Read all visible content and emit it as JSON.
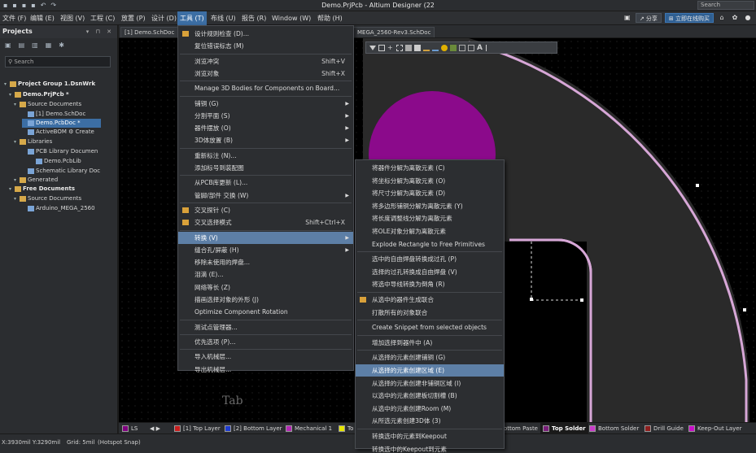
{
  "app": {
    "title": "Demo.PrjPcb - Altium Designer (22",
    "search_placeholder": "Search"
  },
  "quick_icons": [
    "save-icon",
    "save-all-icon",
    "open-icon",
    "folder-icon",
    "undo-icon",
    "redo-icon"
  ],
  "menubar": {
    "items": [
      "文件 (F)",
      "编辑 (E)",
      "视图 (V)",
      "工程 (C)",
      "放置 (P)",
      "设计 (D)",
      "工具 (T)",
      "布线 (U)",
      "报告 (R)",
      "Window (W)",
      "帮助 (H)"
    ],
    "active_index": 6,
    "share": "分享",
    "buy": "立即在线购买"
  },
  "projects_panel": {
    "title": "Projects",
    "search_placeholder": "Search",
    "tree": [
      {
        "label": "Project Group 1.DsnWrk",
        "indent": 0,
        "bold": true
      },
      {
        "label": "Demo.PrjPcb *",
        "indent": 1,
        "bold": true
      },
      {
        "label": "Source Documents",
        "indent": 2
      },
      {
        "label": "[1] Demo.SchDoc",
        "indent": 3
      },
      {
        "label": "Demo.PcbDoc *",
        "indent": 3,
        "selected": true
      },
      {
        "label": "ActiveBOM ⚙  Create",
        "indent": 3
      },
      {
        "label": "Libraries",
        "indent": 2
      },
      {
        "label": "PCB Library Documen",
        "indent": 3
      },
      {
        "label": "Demo.PcbLib",
        "indent": 4
      },
      {
        "label": "Schematic Library Doc",
        "indent": 3
      },
      {
        "label": "Generated",
        "indent": 2
      },
      {
        "label": "Free Documents",
        "indent": 1,
        "bold": true
      },
      {
        "label": "Source Documents",
        "indent": 2
      },
      {
        "label": "Arduino_MEGA_2560",
        "indent": 3
      }
    ]
  },
  "doc_tabs": [
    "[1] Demo.SchDoc",
    "MEGA_2560-Rev3.SchDoc"
  ],
  "canvas": {
    "ghost_text": "Tab",
    "colors": {
      "pad": "#8b0a8b",
      "outline": "#d7a7d7",
      "board": "#2a2a2a"
    }
  },
  "tools_menu": {
    "items": [
      {
        "label": "设计规则检查 (D)...",
        "icon": "drc-icon"
      },
      {
        "label": "复位错误标志 (M)"
      },
      {
        "sep": true
      },
      {
        "label": "浏览冲突",
        "shortcut": "Shift+V"
      },
      {
        "label": "浏览对象",
        "shortcut": "Shift+X"
      },
      {
        "sep": true
      },
      {
        "label": "Manage 3D Bodies for Components on Board..."
      },
      {
        "sep": true
      },
      {
        "label": "铺铜 (G)",
        "submenu": true
      },
      {
        "label": "分割平面 (S)",
        "submenu": true
      },
      {
        "label": "器件摆放 (O)",
        "submenu": true
      },
      {
        "label": "3D体放置 (B)",
        "submenu": true
      },
      {
        "sep": true
      },
      {
        "label": "重新标注 (N)..."
      },
      {
        "label": "添加标号到装配图"
      },
      {
        "sep": true
      },
      {
        "label": "从PCB库更新 (L)..."
      },
      {
        "label": "管脚/部件 交换 (W)",
        "submenu": true
      },
      {
        "sep": true
      },
      {
        "label": "交叉探针 (C)",
        "icon": "cross-probe-icon"
      },
      {
        "label": "交叉选择模式",
        "shortcut": "Shift+Ctrl+X",
        "icon": "cross-select-icon"
      },
      {
        "sep": true
      },
      {
        "label": "转换 (V)",
        "submenu": true,
        "highlight": true
      },
      {
        "label": "缝合孔/屏蔽 (H)",
        "submenu": true
      },
      {
        "label": "移除未使用的焊盘..."
      },
      {
        "label": "泪滴 (E)..."
      },
      {
        "label": "网络等长 (Z)"
      },
      {
        "label": "描画选择对象的外形 (J)"
      },
      {
        "label": "Optimize Component Rotation"
      },
      {
        "sep": true
      },
      {
        "label": "测试点管理器..."
      },
      {
        "sep": true
      },
      {
        "label": "优先选项 (P)..."
      },
      {
        "sep": true
      },
      {
        "label": "导入机械层..."
      },
      {
        "label": "导出机械层..."
      }
    ]
  },
  "convert_menu": {
    "items": [
      {
        "label": "将器件分解为离散元素 (C)"
      },
      {
        "label": "将坐标分解为离散元素 (O)"
      },
      {
        "label": "将尺寸分解为离散元素 (D)"
      },
      {
        "label": "将多边形铺铜分解为离散元素 (Y)"
      },
      {
        "label": "将长度调整线分解为离散元素"
      },
      {
        "label": "将OLE对象分解为离散元素"
      },
      {
        "label": "Explode Rectangle to Free Primitives"
      },
      {
        "sep": true
      },
      {
        "label": "选中的自由焊盘转换成过孔 (P)"
      },
      {
        "label": "选择的过孔转换成自由焊盘 (V)"
      },
      {
        "label": "将选中导线转换为倒角 (R)"
      },
      {
        "sep": true
      },
      {
        "label": "从选中的器件生成联合",
        "icon": "union-icon"
      },
      {
        "label": "打散所有的对象联合"
      },
      {
        "sep": true
      },
      {
        "label": "Create Snippet from selected objects"
      },
      {
        "sep": true
      },
      {
        "label": "增加选择到器件中 (A)"
      },
      {
        "sep": true
      },
      {
        "label": "从选择的元素创建铺铜 (G)"
      },
      {
        "label": "从选择的元素创建区域 (E)",
        "highlight": true
      },
      {
        "label": "从选择的元素创建非铺铜区域 (I)"
      },
      {
        "label": "以选中的元素创建板切割槽 (B)"
      },
      {
        "label": "从选中的元素创建Room (M)"
      },
      {
        "label": "从所选元素创建3D体 (3)"
      },
      {
        "sep": true
      },
      {
        "label": "转换选中的元素到Keepout"
      },
      {
        "label": "转换选中的Keepout到元素"
      }
    ]
  },
  "layers": [
    {
      "label": "LS",
      "color": "#800080"
    },
    {
      "label": "[1] Top Layer",
      "color": "#c81e1e"
    },
    {
      "label": "[2] Bottom Layer",
      "color": "#1e3ccf"
    },
    {
      "label": "Mechanical 1",
      "color": "#b428b4"
    },
    {
      "label": "To",
      "color": "#e6e600"
    },
    {
      "label": "ottom Paste",
      "color": "#4a4a4a"
    },
    {
      "label": "Top Solder",
      "color": "#7a1e7a",
      "active": true
    },
    {
      "label": "Bottom Solder",
      "color": "#c83cc8"
    },
    {
      "label": "Drill Guide",
      "color": "#8c1e1e"
    },
    {
      "label": "Keep-Out Layer",
      "color": "#c80fc8"
    }
  ],
  "status": {
    "coords": "X:3930mil Y:3290mil",
    "grid": "Grid: 5mil",
    "snap": "(Hotspot Snap)"
  }
}
